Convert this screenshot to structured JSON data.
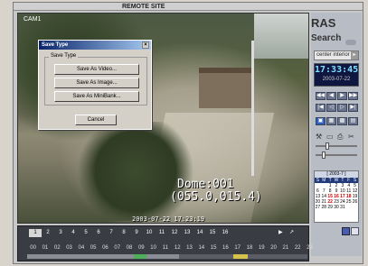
{
  "window": {
    "title": "REMOTE SITE"
  },
  "video": {
    "camera_label": "CAM1",
    "dome_line1": "Dome:001",
    "dome_line2": "(055.0,015.4)",
    "timestamp": "2003-07-22 17:23:19"
  },
  "dialog": {
    "title": "Save Type",
    "close_glyph": "×",
    "group_label": "Save Type",
    "buttons": [
      "Save As Video...",
      "Save As Image...",
      "Save As MiniBank..."
    ],
    "cancel_label": "Cancel"
  },
  "panel": {
    "logo_main": "RAS",
    "logo_sub": "Search",
    "site_selector": "center interior",
    "selector_arrow": "▸",
    "time": "17:33:45",
    "date": "2003-07-22",
    "calendar_header": "[ 2003-7 ]",
    "calendar_dow": [
      "S",
      "M",
      "T",
      "W",
      "T",
      "F",
      "S"
    ],
    "calendar_days": [
      "",
      "",
      "1",
      "2",
      "3",
      "4",
      "5",
      "6",
      "7",
      "8",
      "9",
      "10",
      "11",
      "12",
      "13",
      "14",
      "15",
      "16",
      "17",
      "18",
      "19",
      "20",
      "21",
      "22",
      "23",
      "24",
      "25",
      "26",
      "27",
      "28",
      "29",
      "30",
      "31",
      "",
      ""
    ]
  },
  "timeline": {
    "tabs": [
      "1",
      "2",
      "3",
      "4",
      "5",
      "6",
      "7",
      "8",
      "9",
      "10",
      "11",
      "12",
      "13",
      "14",
      "15",
      "16"
    ],
    "active_tab": "1",
    "hours": [
      "00",
      "01",
      "02",
      "03",
      "04",
      "05",
      "06",
      "07",
      "08",
      "09",
      "10",
      "11",
      "12",
      "13",
      "14",
      "15",
      "16",
      "17",
      "18",
      "19",
      "20",
      "21",
      "22",
      "23"
    ]
  },
  "colors": {
    "accent": "#2f5fbf",
    "record": "#c00000",
    "motion": "#4fae5a"
  }
}
